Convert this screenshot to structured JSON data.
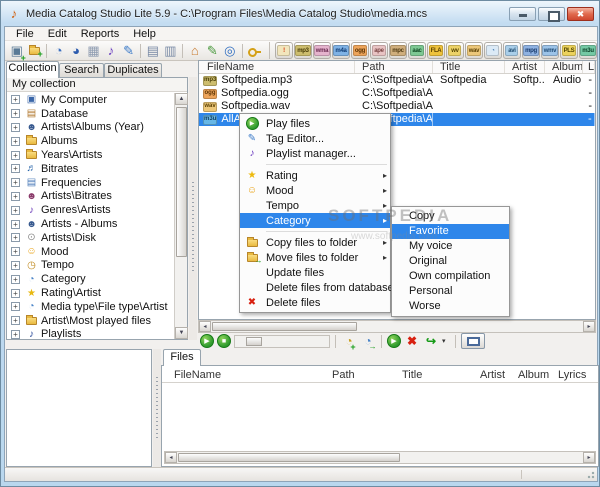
{
  "window": {
    "title": "Media Catalog Studio Lite 5.9 - C:\\Program Files\\Media Catalog Studio\\media.mcs"
  },
  "menu_bar": {
    "items": [
      "File",
      "Edit",
      "Reports",
      "Help"
    ]
  },
  "toolbar": {
    "icons": [
      {
        "name": "add-files",
        "glyph": "▣",
        "color": "#5a7a96"
      },
      {
        "name": "add-folder",
        "glyph": "",
        "color": ""
      },
      {
        "name": "disc",
        "glyph": "◔",
        "color": "#3a6fc0"
      },
      {
        "name": "pie-chart",
        "glyph": "◕",
        "color": "#2d5cae"
      },
      {
        "name": "calendar",
        "glyph": "▦",
        "color": "#8d9bb0"
      },
      {
        "name": "music-note",
        "glyph": "♪",
        "color": "#6a3fc0"
      },
      {
        "name": "edit",
        "glyph": "✎",
        "color": "#3a7ac8"
      },
      {
        "name": "report",
        "glyph": "▤",
        "color": "#7a8ba6"
      },
      {
        "name": "report-edit",
        "glyph": "▥",
        "color": "#7a8ba6"
      },
      {
        "name": "home",
        "glyph": "⌂",
        "color": "#c87a2e"
      },
      {
        "name": "tools",
        "glyph": "✎",
        "color": "#4a9a3e"
      },
      {
        "name": "globe",
        "glyph": "◎",
        "color": "#2d6cc0"
      },
      {
        "name": "key",
        "glyph": "",
        "color": "#d4a017"
      }
    ],
    "formats": [
      {
        "label": "!",
        "bg": "#f2e6bc",
        "fg": "#d2300a"
      },
      {
        "label": "mp3",
        "bg": "#cdbd6e",
        "fg": "#463a06"
      },
      {
        "label": "wma",
        "bg": "#e5b3cd",
        "fg": "#6b2c52"
      },
      {
        "label": "m4a",
        "bg": "#7fb2e5",
        "fg": "#0e3a72"
      },
      {
        "label": "ogg",
        "bg": "#eda45a",
        "fg": "#5c3404"
      },
      {
        "label": "ape",
        "bg": "#e8c3c3",
        "fg": "#7a4444"
      },
      {
        "label": "mpc",
        "bg": "#cfae7c",
        "fg": "#4e3a12"
      },
      {
        "label": "aac",
        "bg": "#7ec893",
        "fg": "#114a24"
      },
      {
        "label": "FLA",
        "bg": "#eec23c",
        "fg": "#5a4000"
      },
      {
        "label": "wv",
        "bg": "#ecd268",
        "fg": "#554400"
      },
      {
        "label": "wav",
        "bg": "#ecc77a",
        "fg": "#5a4004"
      },
      {
        "label": "◔",
        "bg": "#dceaf6",
        "fg": "#3a74b0"
      },
      {
        "label": "avi",
        "bg": "#a9cee9",
        "fg": "#1e4a6e"
      },
      {
        "label": "mpg",
        "bg": "#8fb2e2",
        "fg": "#16386a"
      },
      {
        "label": "wmv",
        "bg": "#9cc3e8",
        "fg": "#1e4a74"
      },
      {
        "label": "PLS",
        "bg": "#ecd25c",
        "fg": "#504400"
      },
      {
        "label": "m3u",
        "bg": "#74c9a4",
        "fg": "#0c4228"
      }
    ]
  },
  "left_panel": {
    "tabs": [
      "Collection",
      "Search",
      "Duplicates"
    ],
    "header": "My collection",
    "expand_glyph": "+",
    "tree": [
      {
        "label": "My Computer",
        "glyph": "▣",
        "color": "#3a66a8"
      },
      {
        "label": "Database",
        "glyph": "▤",
        "color": "#b0762a"
      },
      {
        "label": "Artists\\Albums (Year)",
        "glyph": "☻",
        "color": "#37598f"
      },
      {
        "label": "Albums",
        "glyph": "",
        "color": ""
      },
      {
        "label": "Years\\Artists",
        "glyph": "",
        "color": ""
      },
      {
        "label": "Bitrates",
        "glyph": "♬",
        "color": "#2a66aa"
      },
      {
        "label": "Frequencies",
        "glyph": "▤",
        "color": "#4a7ab8"
      },
      {
        "label": "Artists\\Bitrates",
        "glyph": "☻",
        "color": "#8a3a6a"
      },
      {
        "label": "Genres\\Artists",
        "glyph": "♪",
        "color": "#6a3ab8"
      },
      {
        "label": "Artists - Albums",
        "glyph": "☻",
        "color": "#37598f"
      },
      {
        "label": "Artists\\Disk",
        "glyph": "⊙",
        "color": "#8a8a8a"
      },
      {
        "label": "Mood",
        "glyph": "☺",
        "color": "#e8a010"
      },
      {
        "label": "Tempo",
        "glyph": "◷",
        "color": "#c08a20"
      },
      {
        "label": "Category",
        "glyph": "◔",
        "color": "#4a84c8"
      },
      {
        "label": "Rating\\Artist",
        "glyph": "★",
        "color": "#e8b810"
      },
      {
        "label": "Media type\\File type\\Artist",
        "glyph": "◔",
        "color": "#4a84c8"
      },
      {
        "label": "Artist\\Most played files",
        "glyph": "",
        "color": ""
      },
      {
        "label": "Playlists",
        "glyph": "♪",
        "color": "#2a4a9a"
      }
    ]
  },
  "file_list": {
    "columns": [
      "FileName",
      "Path",
      "Title",
      "Artist",
      "Album",
      "Ly"
    ],
    "rows": [
      {
        "type": "mp3",
        "type_bg": "#cdbd6e",
        "type_fg": "#463a06",
        "name": "Softpedia.mp3",
        "path": "C:\\Softpedia\\Au...",
        "title": "Softpedia",
        "artist": "Softp...",
        "album": "Audio",
        "lyrics": "-"
      },
      {
        "type": "ogg",
        "type_bg": "#eda45a",
        "type_fg": "#5c3404",
        "name": "Softpedia.ogg",
        "path": "C:\\Softpedia\\Au...",
        "title": "",
        "artist": "",
        "album": "",
        "lyrics": "-"
      },
      {
        "type": "wav",
        "type_bg": "#ecc77a",
        "type_fg": "#5a4004",
        "name": "Softpedia.wav",
        "path": "C:\\Softpedia\\Au...",
        "title": "",
        "artist": "",
        "album": "",
        "lyrics": "-"
      },
      {
        "type": "m3u",
        "type_bg": "#67b7e6",
        "type_fg": "#0c3a5c",
        "name": "AllAudio...",
        "path": "C:\\Softpedia\\Au...",
        "title": "",
        "artist": "",
        "album": "",
        "lyrics": "-"
      }
    ]
  },
  "context_menu": {
    "arrow": "▸",
    "items": [
      {
        "label": "Play files"
      },
      {
        "label": "Tag Editor..."
      },
      {
        "label": "Playlist manager..."
      },
      {
        "label": "Rating",
        "icon_glyph": "★",
        "icon_color": "#edb90c"
      },
      {
        "label": "Mood",
        "icon_glyph": "☺",
        "icon_color": "#e8a010"
      },
      {
        "label": "Tempo"
      },
      {
        "label": "Category",
        "icon_glyph": "◔",
        "icon_color": "#4a84c8"
      },
      {
        "label": "Copy files to folder"
      },
      {
        "label": "Move files to folder"
      },
      {
        "label": "Update files"
      },
      {
        "label": "Delete files from database"
      },
      {
        "label": "Delete files",
        "icon_glyph": "✖",
        "icon_color": "#d82010"
      }
    ],
    "tag_glyph": "✎",
    "tag_color": "#3a7ac8",
    "note_glyph": "♪",
    "note_color": "#6a3ac0",
    "play_glyph": "▶"
  },
  "submenu": {
    "items": [
      "Copy",
      "Favorite",
      "My voice",
      "Original",
      "Own compilation",
      "Personal",
      "Worse"
    ]
  },
  "player_bar": {
    "play_glyph": "▶",
    "stop_glyph": "■",
    "cd_glyph": "◔",
    "delete_glyph": "✖",
    "export_glyph": "↪",
    "caret_glyph": "▾"
  },
  "bottom_panel": {
    "tab": "Files",
    "columns": [
      "FileName",
      "Path",
      "Title",
      "Artist",
      "Album",
      "Lyrics"
    ]
  },
  "watermark": {
    "line1": "SOFTPEDIA",
    "line2": "www.softpedia.com"
  }
}
